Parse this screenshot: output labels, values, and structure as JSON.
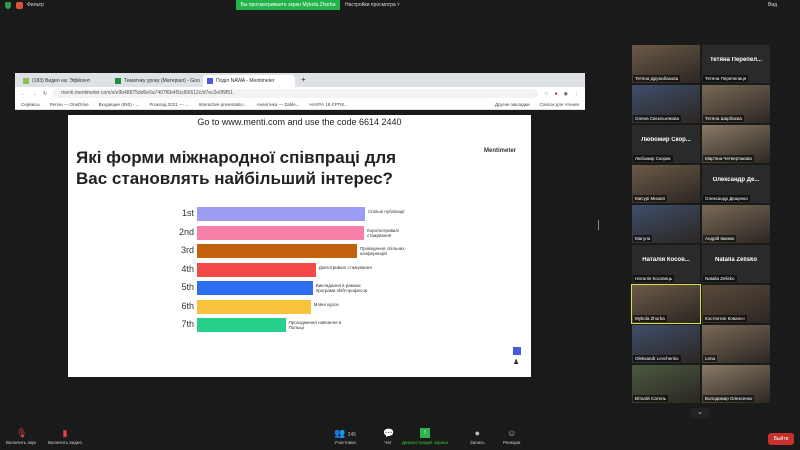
{
  "top": {
    "label": "Фильтр",
    "banner": "Вы просматриваете экран Mykola Zhurba",
    "view_settings": "Настройки просмотра ˅",
    "view": "Вид"
  },
  "browser": {
    "tabs": [
      "(183) Видео на: Эфйсент",
      "Тематику уроку (Матеріал) - Goo",
      "Поділ NAWA - Mentimeter"
    ],
    "url": "menti.mentimeter.com/s/e9b48875dd6e0a7407f6b4f3cd56612c/d7ec2e0f9f51",
    "bookmarks": [
      "Сервисы",
      "Регіон — OneDrive",
      "Входящие (850) - ...",
      "Розклад 2021 — ...",
      "Interactive presentatio...",
      "Аналітика — Zable...",
      "НАУРА 18 ЄРТІК...",
      "Другие закладки",
      "Список для чтения"
    ]
  },
  "slide": {
    "code_line": "Go to www.menti.com and use the code 6614 2440",
    "question": "Які форми міжнародної співпраці для Вас становлять найбільший інтерес?",
    "brand": "Mentimeter"
  },
  "chart_data": {
    "type": "bar",
    "orientation": "horizontal",
    "title": "Які форми міжнародної співпраці для Вас становлять найбільший інтерес?",
    "categories": [
      "1st",
      "2nd",
      "3rd",
      "4th",
      "5th",
      "6th",
      "7th"
    ],
    "labels": [
      "Спільні публікації",
      "Короткотривалі стажування",
      "Проведення спільних конференцій",
      "Довготривалі стажування",
      "Викладання в рамках програми shift-професор",
      "Мовні курси",
      "Проходження навчання в Польщі"
    ],
    "values": [
      167,
      166,
      159,
      118,
      115,
      113,
      88
    ],
    "colors": [
      "#9b9cf2",
      "#f780a8",
      "#c3610c",
      "#f54848",
      "#2e6ef0",
      "#f9c23c",
      "#27d18b"
    ]
  },
  "gallery": [
    {
      "name": "Тетяна Друзюбакова",
      "video": true
    },
    {
      "name": "Тетяна Перепелиця",
      "big": "Тетяна Перепел...",
      "video": false
    },
    {
      "name": "Олена Свєкльнякова",
      "video": true
    },
    {
      "name": "Тетяна Шарбаєва",
      "video": true
    },
    {
      "name": "Любомир Скорик",
      "big": "Любомир Скор...",
      "video": false
    },
    {
      "name": "Мар'яна Четвертакова",
      "video": true
    },
    {
      "name": "Мисурі Михаїл",
      "video": true
    },
    {
      "name": "Олександр Дещенко",
      "big": "Олександр Де...",
      "video": false
    },
    {
      "name": "Магула",
      "video": true
    },
    {
      "name": "Андрій Іванюк",
      "video": true
    },
    {
      "name": "Наталія Косовець",
      "big": "Наталія Косов...",
      "video": false
    },
    {
      "name": "Natalia Zelisko",
      "big": "Natalia Zelisko",
      "video": false
    },
    {
      "name": "Mykola Zhurba",
      "video": true,
      "speaking": true
    },
    {
      "name": "Костянтин Ковальч",
      "video": true
    },
    {
      "name": "Oleksandr Levchenko",
      "video": true
    },
    {
      "name": "Lena",
      "video": true
    },
    {
      "name": "Віталій Сатель",
      "video": true
    },
    {
      "name": "Володимир Олексенко",
      "video": true
    }
  ],
  "toolbar": {
    "audio": "Включить звук",
    "video": "Включить видео",
    "participants": "Участники",
    "participants_count": "245",
    "chat": "Чат",
    "share": "Демонстрация экрана",
    "record": "Запись",
    "reactions": "Реакции",
    "leave": "Выйти"
  }
}
